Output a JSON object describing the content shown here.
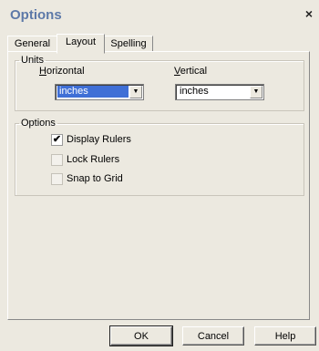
{
  "window": {
    "title": "Options",
    "close_label": "×"
  },
  "tabs": [
    {
      "label": "General",
      "active": false
    },
    {
      "label": "Layout",
      "active": true
    },
    {
      "label": "Spelling",
      "active": false
    }
  ],
  "units": {
    "legend": "Units",
    "horizontal": {
      "label_mnemonic": "H",
      "label_rest": "orizontal",
      "value": "inches"
    },
    "vertical": {
      "label_mnemonic": "V",
      "label_rest": "ertical",
      "value": "inches"
    }
  },
  "options": {
    "legend": "Options",
    "items": [
      {
        "label": "Display Rulers",
        "checked": true,
        "mark": "✔"
      },
      {
        "label": "Lock Rulers",
        "checked": false,
        "mark": ""
      },
      {
        "label": "Snap to Grid",
        "checked": false,
        "mark": ""
      }
    ]
  },
  "buttons": {
    "ok": "OK",
    "cancel": "Cancel",
    "help": "Help"
  },
  "icons": {
    "dropdown": "▼"
  }
}
